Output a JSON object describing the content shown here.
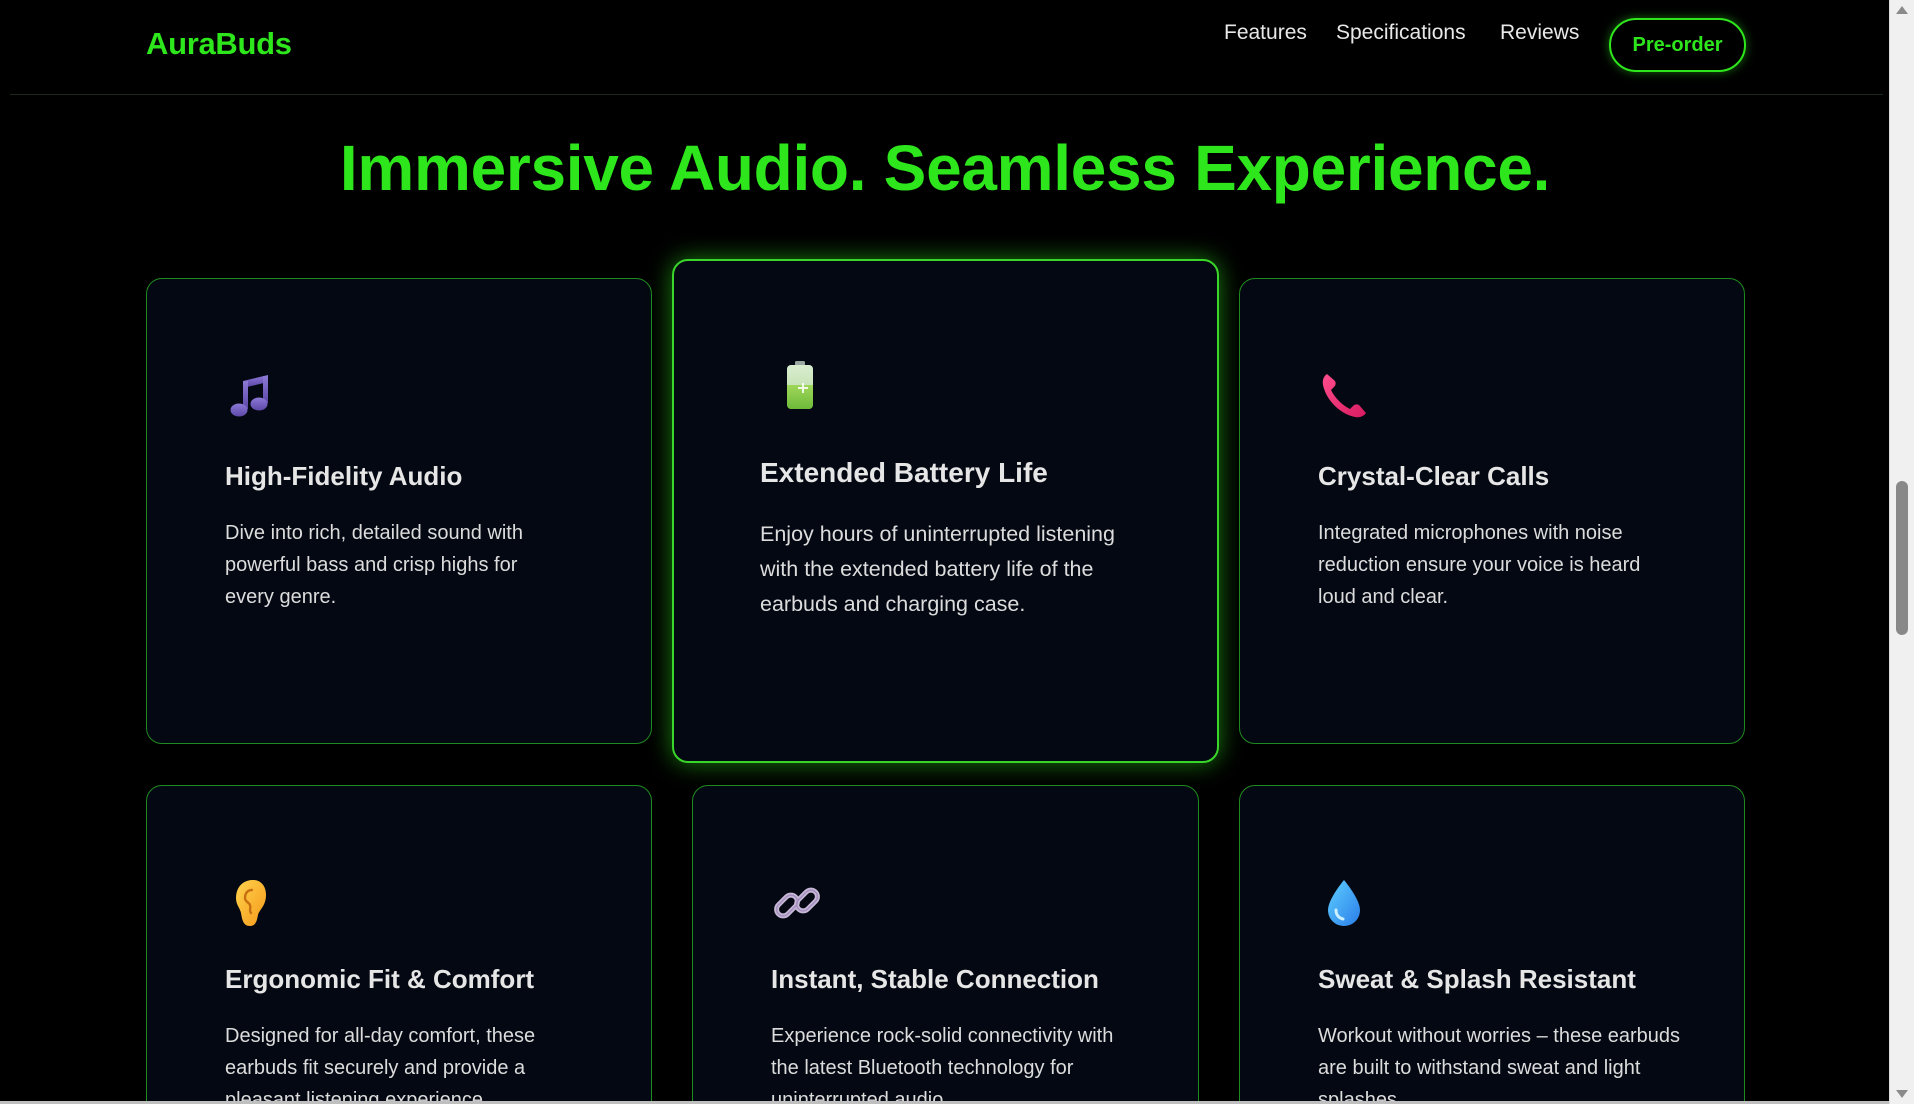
{
  "header": {
    "logo": "AuraBuds",
    "nav": [
      "Features",
      "Specifications",
      "Reviews"
    ],
    "cta": "Pre-order"
  },
  "hero": {
    "title": "Immersive Audio. Seamless Experience."
  },
  "features": [
    {
      "icon": "music-note-icon",
      "title": "High-Fidelity Audio",
      "description": "Dive into rich, detailed sound with powerful bass and crisp highs for every genre."
    },
    {
      "icon": "battery-icon",
      "title": "Extended Battery Life",
      "description": "Enjoy hours of uninterrupted listening with the extended battery life of the earbuds and charging case."
    },
    {
      "icon": "phone-icon",
      "title": "Crystal-Clear Calls",
      "description": "Integrated microphones with noise reduction ensure your voice is heard loud and clear."
    },
    {
      "icon": "ear-icon",
      "title": "Ergonomic Fit & Comfort",
      "description": "Designed for all-day comfort, these earbuds fit securely and provide a pleasant listening experience."
    },
    {
      "icon": "link-icon",
      "title": "Instant, Stable Connection",
      "description": "Experience rock-solid connectivity with the latest Bluetooth technology for uninterrupted audio."
    },
    {
      "icon": "droplet-icon",
      "title": "Sweat & Splash Resistant",
      "description": "Workout without worries – these earbuds are built to withstand sweat and light splashes."
    }
  ],
  "colors": {
    "accent": "#2ee61c",
    "background": "#000000",
    "card": "#040812"
  }
}
